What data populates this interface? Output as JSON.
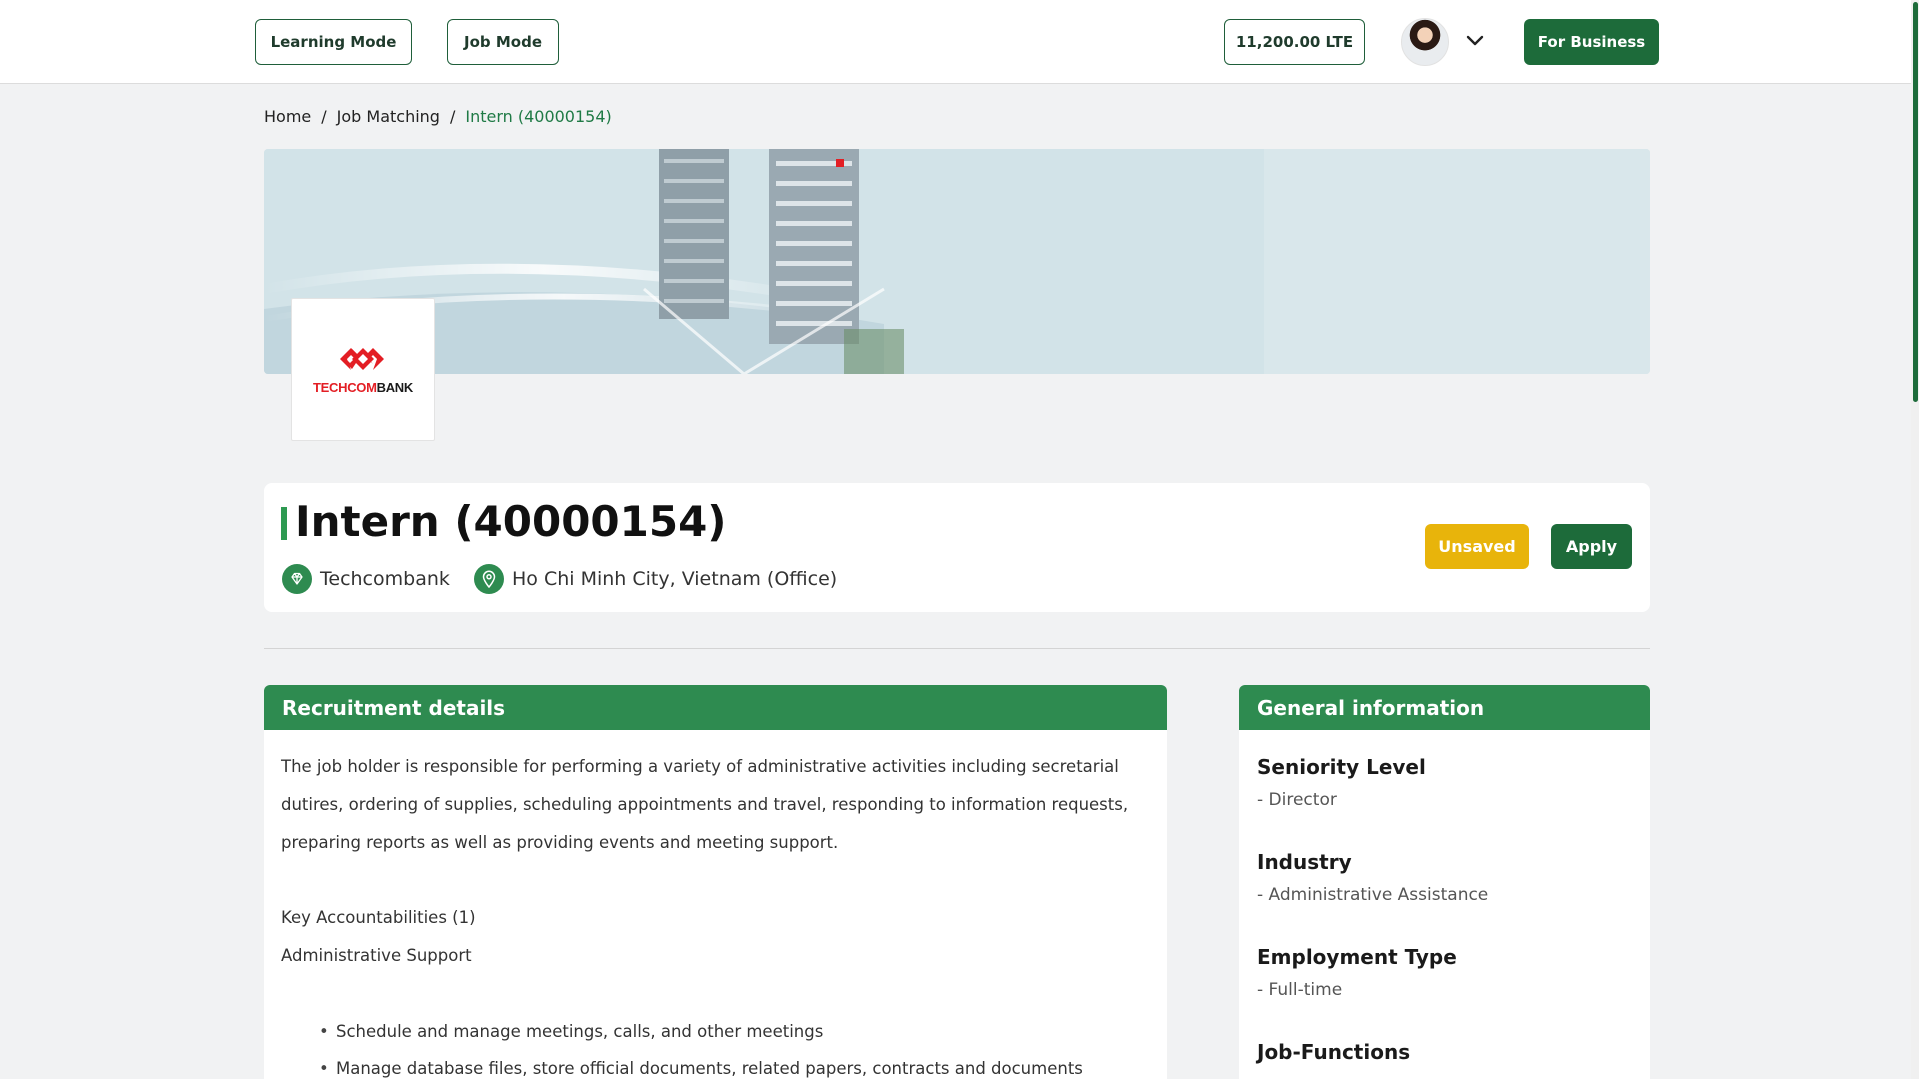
{
  "nav": {
    "learning_mode": "Learning Mode",
    "job_mode": "Job Mode",
    "balance": "11,200.00 LTE",
    "for_business": "For Business"
  },
  "breadcrumb": {
    "home": "Home",
    "sep": "/",
    "job_matching": "Job Matching",
    "current": "Intern (40000154)"
  },
  "company": {
    "logo_red": "TECHCOM",
    "logo_dark": "BANK",
    "brand_color": "#e31e24"
  },
  "job": {
    "title": "Intern (40000154)",
    "company": "Techcombank",
    "location": "Ho Chi Minh City, Vietnam (Office)",
    "unsaved_label": "Unsaved",
    "apply_label": "Apply"
  },
  "recruitment": {
    "heading": "Recruitment details",
    "description": "The job holder is responsible for performing a variety of administrative activities including secretarial dutires, ordering of supplies, scheduling appointments and travel, responding to information requests, preparing reports as well as providing events and meeting support.",
    "key_accountabilities": "Key Accountabilities (1)",
    "section_title": "Administrative Support",
    "bullets": [
      "Schedule and manage meetings, calls, and other meetings",
      "Manage database files, store official documents, related papers, contracts and documents"
    ]
  },
  "general_info": {
    "heading": "General information",
    "items": [
      {
        "label": "Seniority Level",
        "value": "- Director"
      },
      {
        "label": "Industry",
        "value": "- Administrative Assistance"
      },
      {
        "label": "Employment Type",
        "value": "- Full-time"
      },
      {
        "label": "Job-Functions",
        "value": ""
      }
    ]
  },
  "colors": {
    "primary": "#1d6b3a",
    "accent_green": "#2e8b50",
    "warning": "#e8b40b"
  }
}
